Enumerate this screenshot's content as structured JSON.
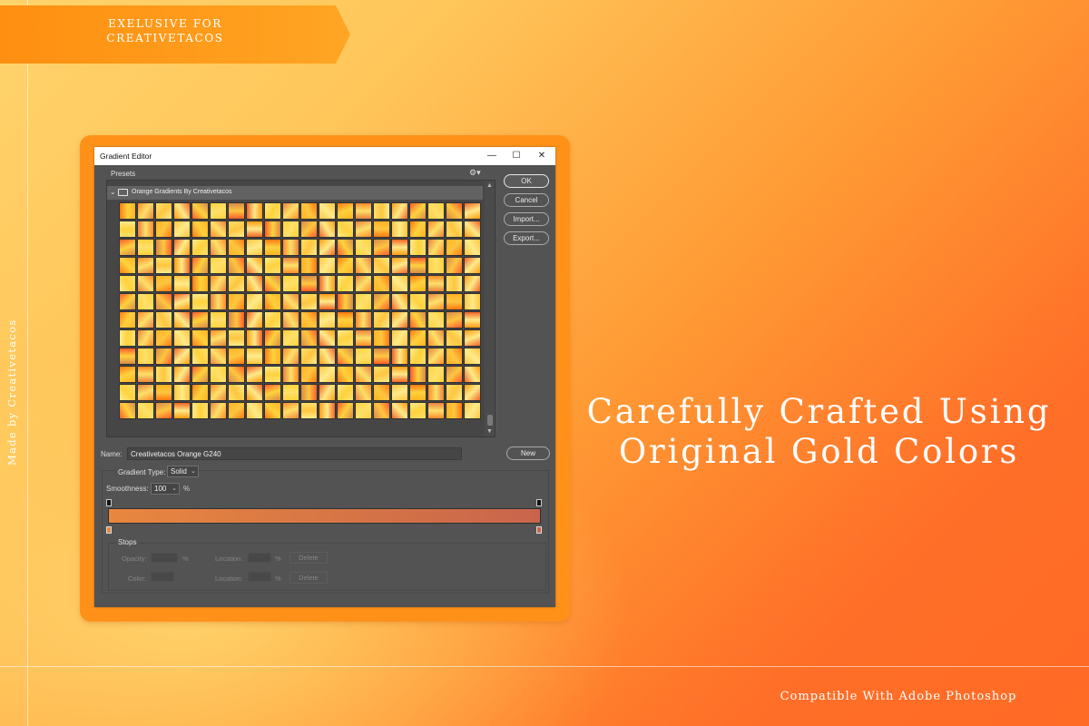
{
  "ribbon": {
    "line1": "EXELUSIVE FOR",
    "line2": "CREATIVETACOS"
  },
  "side_credit": "Made by Creativetacos",
  "headline": {
    "line1": "Carefully Crafted Using",
    "line2": "Original Gold Colors"
  },
  "footer": "Compatible With Adobe Photoshop",
  "dialog": {
    "title": "Gradient Editor",
    "window_controls": {
      "minimize": "—",
      "maximize": "☐",
      "close": "✕"
    },
    "presets": {
      "label": "Presets",
      "gear_icon": "gear-icon",
      "folder_label": "Orange Gradients By Creativetacos",
      "swatch_count": 240,
      "swatch_palette": [
        "#ff9c12",
        "#ffb322",
        "#ffd23d",
        "#ff7a10",
        "#f26524",
        "#ffe06a",
        "#e9843c",
        "#ff5d2a",
        "#ffc640",
        "#d98a47",
        "#ff8c2a",
        "#ffea8a"
      ]
    },
    "buttons": {
      "ok": "OK",
      "cancel": "Cancel",
      "import": "Import...",
      "export": "Export...",
      "new": "New"
    },
    "name": {
      "label": "Name:",
      "value": "Creativetacos Orange G240"
    },
    "gradient_type": {
      "label": "Gradient Type:",
      "value": "Solid"
    },
    "smoothness": {
      "label": "Smoothness:",
      "value": "100",
      "unit": "%"
    },
    "gradient": {
      "start_color": "#e8873f",
      "end_color": "#c8654c"
    },
    "stops": {
      "label": "Stops",
      "opacity_label": "Opacity:",
      "color_label": "Color:",
      "location_label": "Location:",
      "percent": "%",
      "delete_label": "Delete"
    }
  },
  "colors": {
    "frame": "#ff9119",
    "dialog_bg": "#535353",
    "accent": "#ff7a20"
  }
}
